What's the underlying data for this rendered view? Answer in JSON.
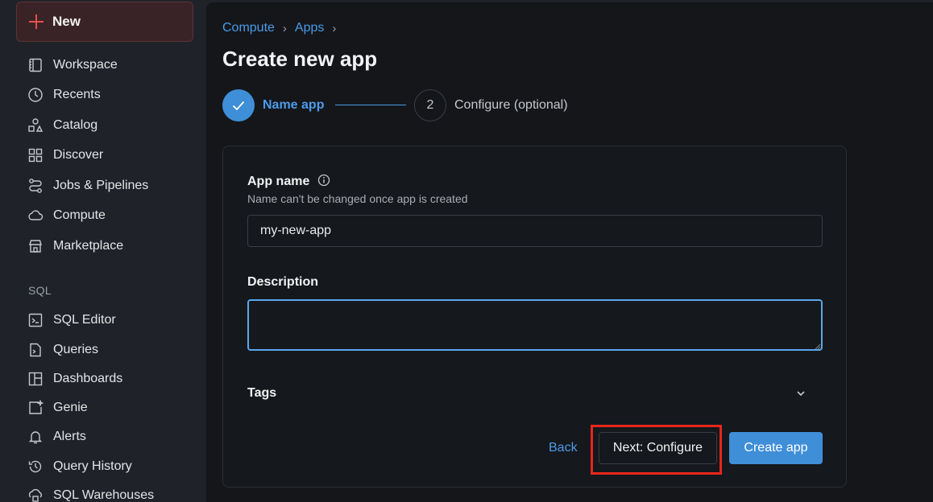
{
  "sidebar": {
    "new_label": "New",
    "items": [
      {
        "label": "Workspace",
        "icon": "workspace-icon"
      },
      {
        "label": "Recents",
        "icon": "clock-icon"
      },
      {
        "label": "Catalog",
        "icon": "catalog-icon"
      },
      {
        "label": "Discover",
        "icon": "grid-icon"
      },
      {
        "label": "Jobs & Pipelines",
        "icon": "jobs-icon"
      },
      {
        "label": "Compute",
        "icon": "cloud-icon"
      },
      {
        "label": "Marketplace",
        "icon": "store-icon"
      }
    ],
    "sql_section_label": "SQL",
    "sql_items": [
      {
        "label": "SQL Editor",
        "icon": "terminal-icon"
      },
      {
        "label": "Queries",
        "icon": "query-file-icon"
      },
      {
        "label": "Dashboards",
        "icon": "dashboard-icon"
      },
      {
        "label": "Genie",
        "icon": "genie-icon"
      },
      {
        "label": "Alerts",
        "icon": "bell-icon"
      },
      {
        "label": "Query History",
        "icon": "history-icon"
      },
      {
        "label": "SQL Warehouses",
        "icon": "warehouse-icon"
      }
    ]
  },
  "breadcrumb": {
    "items": [
      "Compute",
      "Apps"
    ],
    "separator": "›"
  },
  "page_title": "Create new app",
  "stepper": {
    "step1": {
      "label": "Name app",
      "state": "complete"
    },
    "step2": {
      "number": "2",
      "label": "Configure (optional)",
      "state": "pending"
    }
  },
  "form": {
    "app_name_label": "App name",
    "app_name_hint": "Name can't be changed once app is created",
    "app_name_value": "my-new-app",
    "description_label": "Description",
    "description_value": "",
    "tags_label": "Tags"
  },
  "actions": {
    "back_label": "Back",
    "next_label": "Next: Configure",
    "create_label": "Create app"
  },
  "colors": {
    "accent": "#3f8ed8",
    "link": "#4c9be8",
    "highlight": "#e8261b",
    "new_button_plus": "#e5534b"
  }
}
